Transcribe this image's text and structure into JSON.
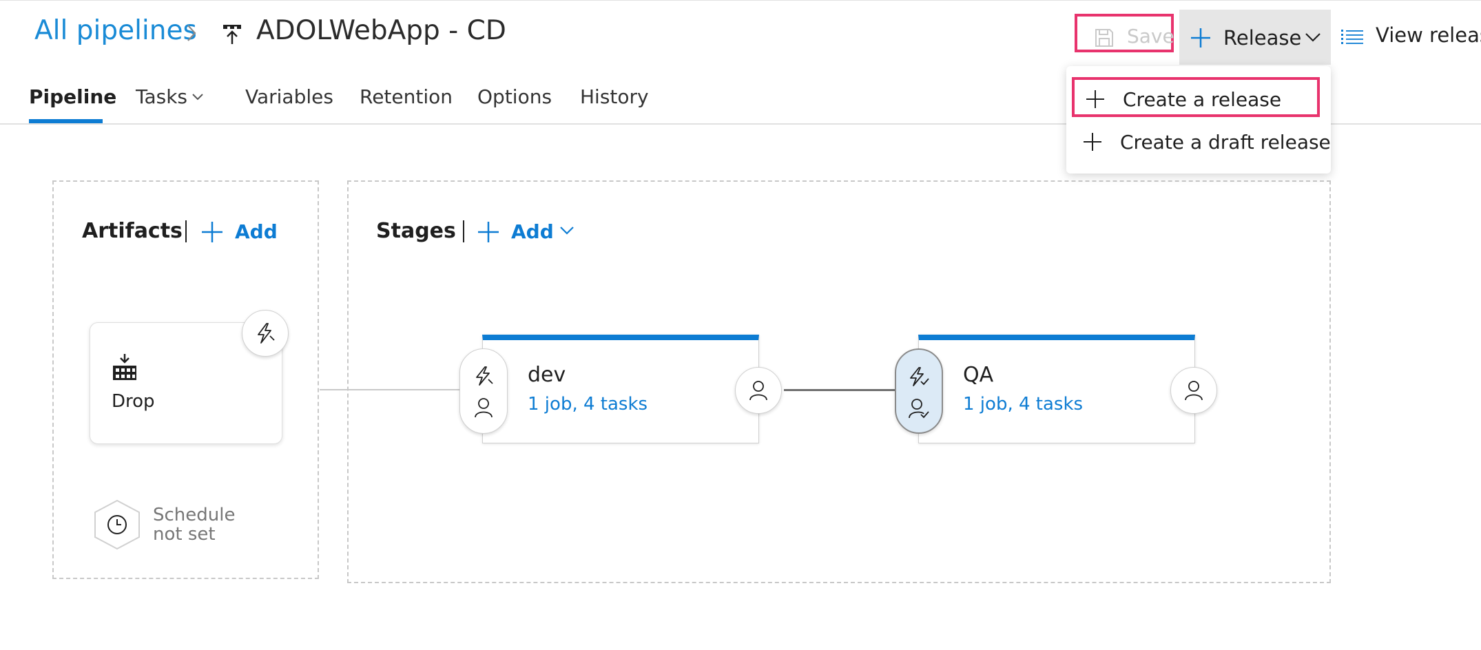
{
  "breadcrumb": {
    "root_label": "All pipelines",
    "separator_icon": "chevron-right-icon",
    "pipeline_icon": "release-pipeline-icon",
    "pipeline_name": "ADOLWebApp - CD"
  },
  "toolbar": {
    "save_label": "Save",
    "save_icon": "save-icon",
    "release_label": "Release",
    "release_icon": "plus-icon",
    "release_chevron_icon": "chevron-down-icon",
    "view_releases_label": "View releases",
    "view_releases_icon": "list-icon"
  },
  "release_menu": {
    "items": [
      {
        "label": "Create a release",
        "icon": "plus-icon",
        "highlighted": true
      },
      {
        "label": "Create a draft release",
        "icon": "plus-icon",
        "highlighted": false
      }
    ]
  },
  "tabs": [
    {
      "label": "Pipeline",
      "active": true
    },
    {
      "label": "Tasks",
      "has_dropdown": true
    },
    {
      "label": "Variables"
    },
    {
      "label": "Retention"
    },
    {
      "label": "Options"
    },
    {
      "label": "History"
    }
  ],
  "artifacts": {
    "title": "Artifacts",
    "add_label": "Add",
    "items": [
      {
        "name": "Drop",
        "icon": "build-artifact-icon",
        "trigger_icon": "lightning-icon"
      }
    ],
    "schedule": {
      "line1": "Schedule",
      "line2": "not set",
      "icon": "clock-icon"
    }
  },
  "stages": {
    "title": "Stages",
    "add_label": "Add",
    "items": [
      {
        "name": "dev",
        "summary": "1 job, 4 tasks",
        "pre_icons": [
          "lightning-icon",
          "person-icon"
        ],
        "post_icon": "person-icon"
      },
      {
        "name": "QA",
        "summary": "1 job, 4 tasks",
        "pre_icons": [
          "lightning-check-icon",
          "person-check-icon"
        ],
        "post_icon": "person-icon",
        "pre_selected": true
      }
    ]
  },
  "colors": {
    "accent": "#0d7cd3",
    "highlight_border": "#e8336d",
    "link": "#1a8bd6",
    "disabled_text": "#c9c9c9"
  }
}
